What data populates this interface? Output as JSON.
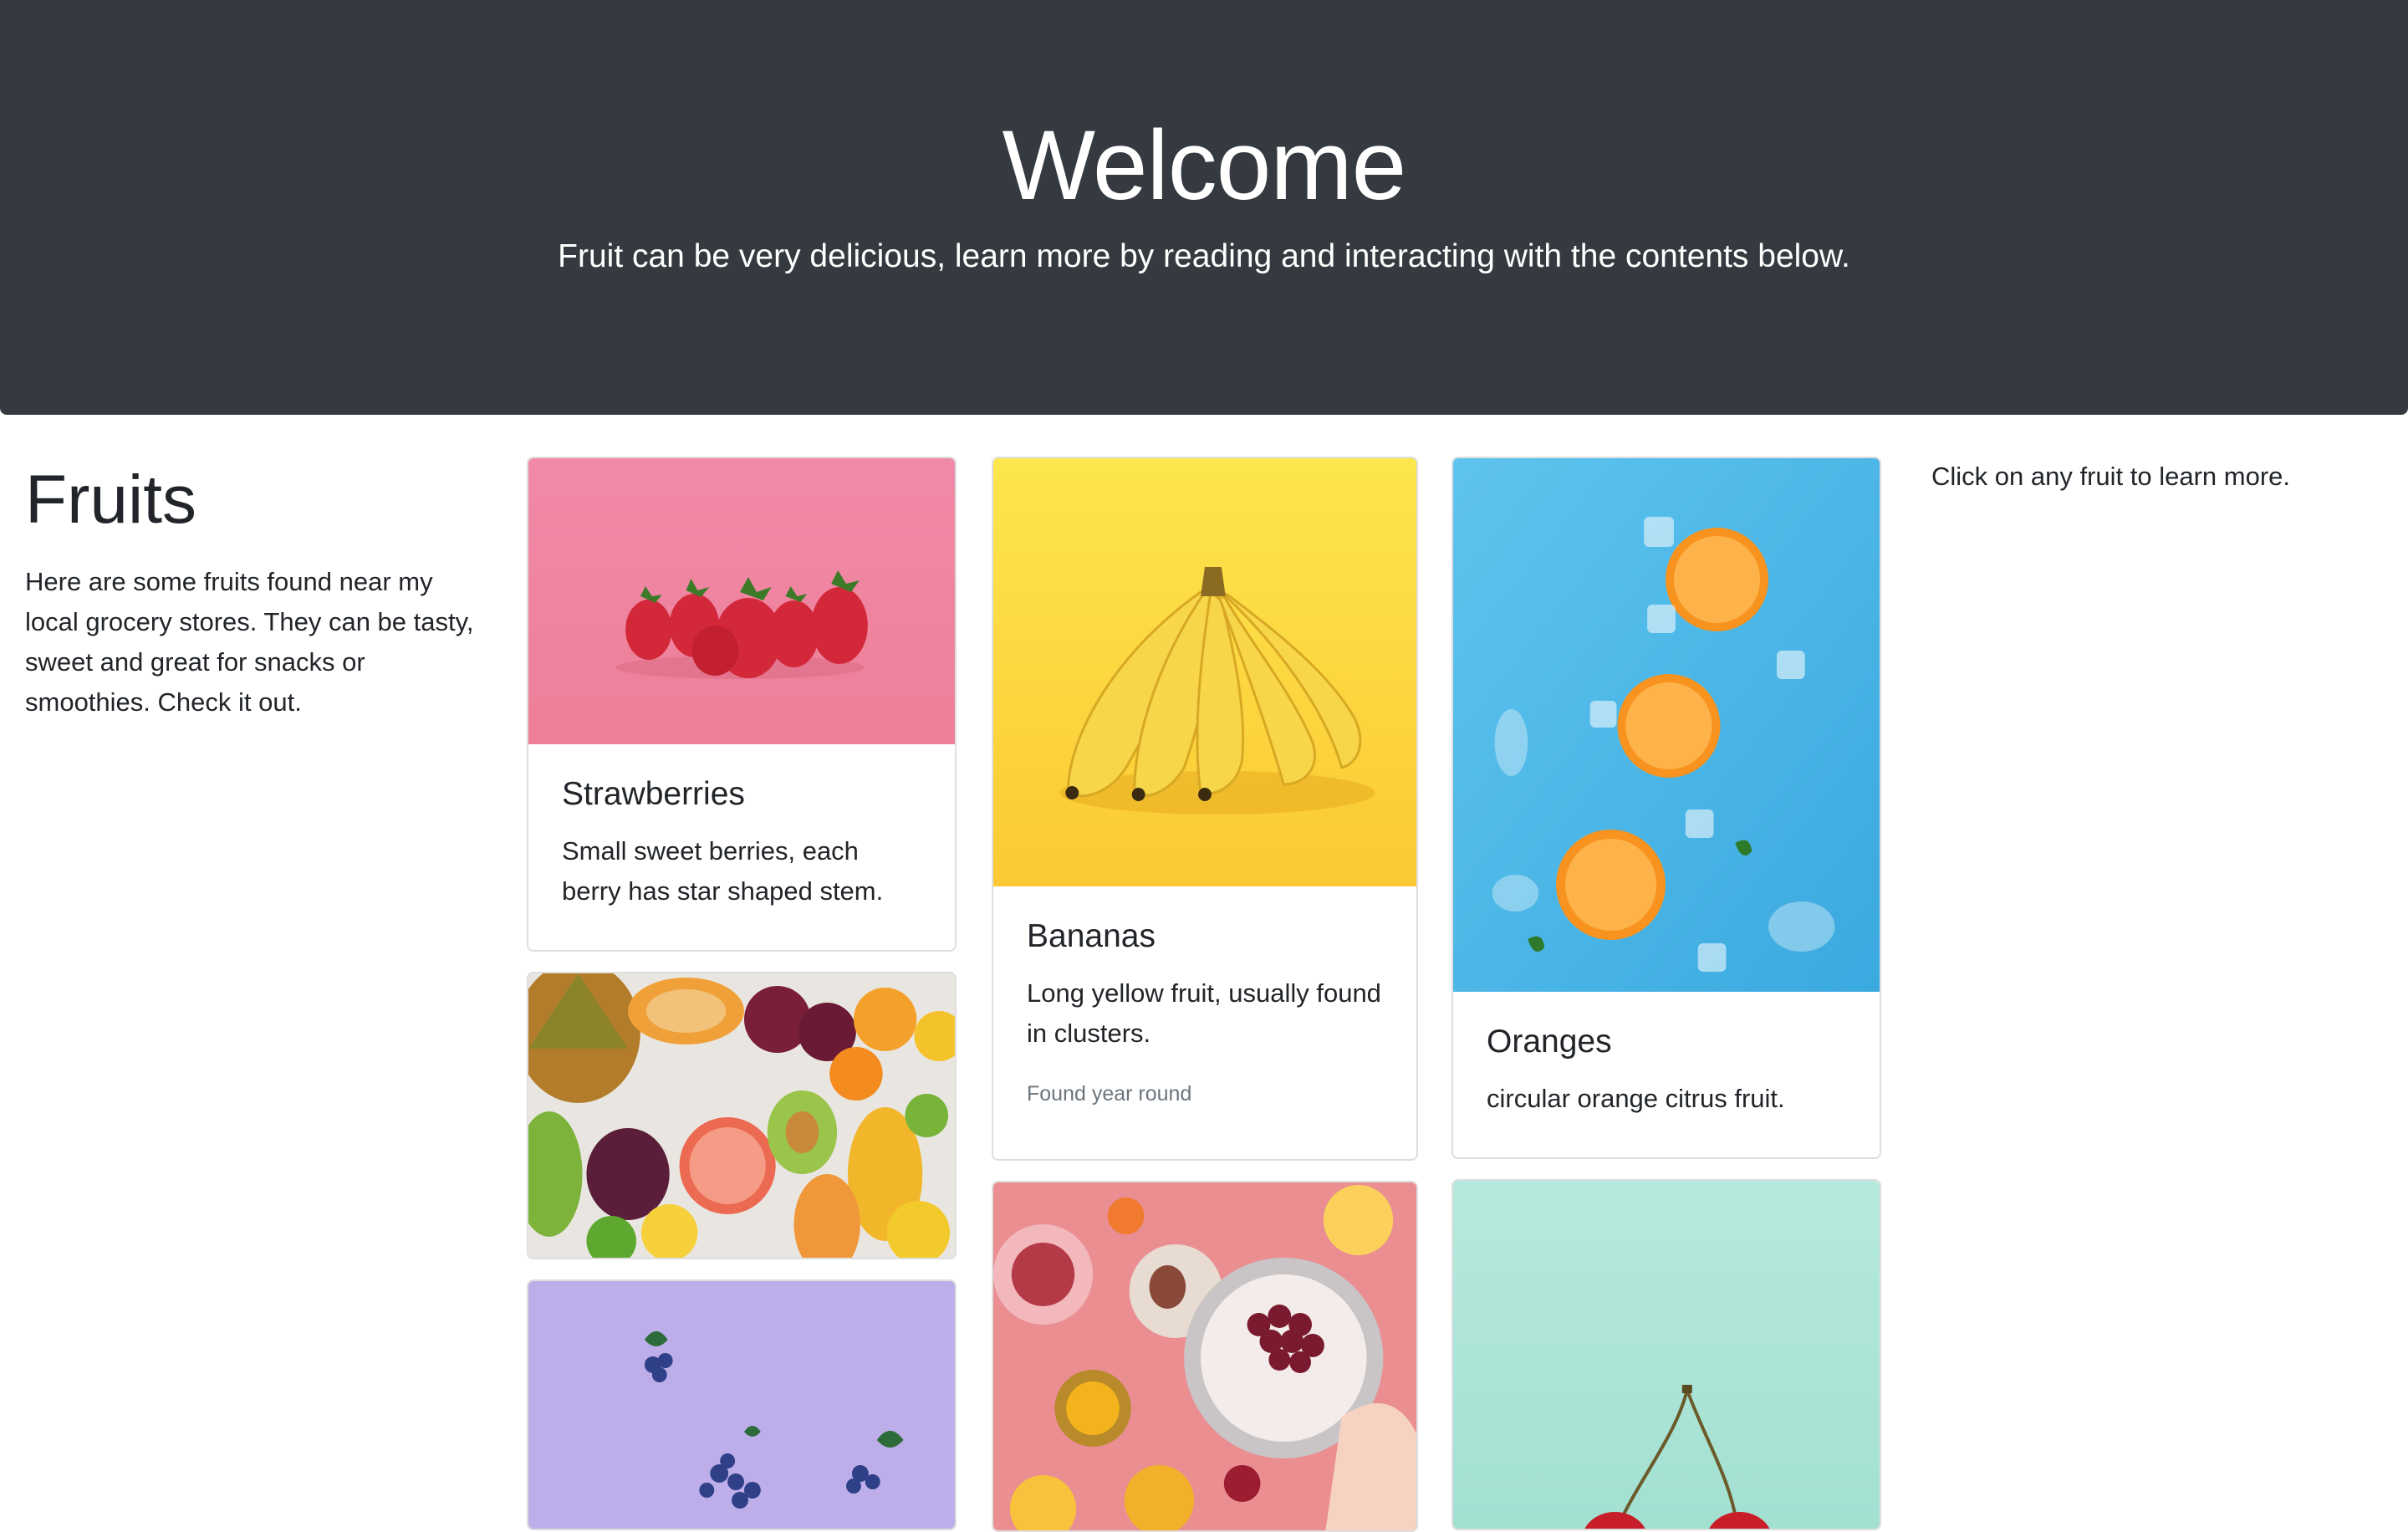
{
  "hero": {
    "title": "Welcome",
    "subtitle": "Fruit can be very delicious, learn more by reading and interacting with the contents below."
  },
  "intro": {
    "heading": "Fruits",
    "text": "Here are some fruits found near my local grocery stores. They can be tasty, sweet and great for snacks or smoothies. Check it out."
  },
  "hint": "Click on any fruit to learn more.",
  "cards": {
    "strawberries": {
      "title": "Strawberries",
      "text": "Small sweet berries, each berry has star shaped stem."
    },
    "bananas": {
      "title": "Bananas",
      "text": "Long yellow fruit, usually found in clusters.",
      "note": "Found year round"
    },
    "oranges": {
      "title": "Oranges",
      "text": "circular orange citrus fruit."
    }
  },
  "colors": {
    "hero_bg": "#343a40",
    "strawberry_bg": "#ee8fa6",
    "banana_bg": "#fde14a",
    "orange_bg": "#56b9e6",
    "blueberry_bg": "#bcaee8",
    "cherry_bg": "#a8e3d6",
    "table_bg": "#ea8e92"
  }
}
